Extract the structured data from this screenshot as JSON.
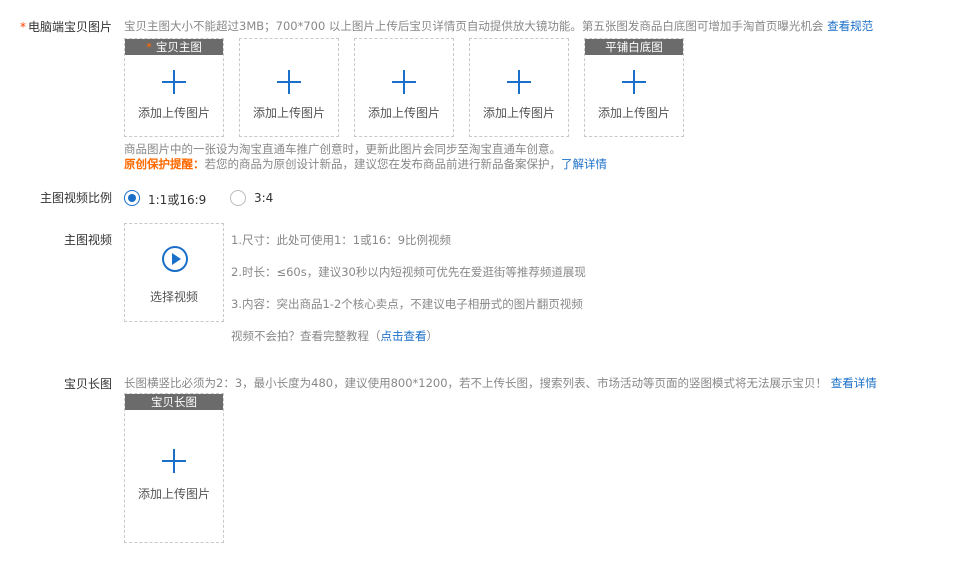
{
  "main_images": {
    "label": "电脑端宝贝图片",
    "required_mark": "*",
    "hint": "宝贝主图大小不能超过3MB；700*700 以上图片上传后宝贝详情页自动提供放大镜功能。第五张图发商品白底图可增加手淘首页曝光机会",
    "hint_link": "查看规范",
    "slots": [
      {
        "tag": "宝贝主图",
        "tag_star": "*",
        "caption": "添加上传图片"
      },
      {
        "tag": "",
        "caption": "添加上传图片"
      },
      {
        "tag": "",
        "caption": "添加上传图片"
      },
      {
        "tag": "",
        "caption": "添加上传图片"
      },
      {
        "tag": "平铺白底图",
        "caption": "添加上传图片"
      }
    ],
    "note": "商品图片中的一张设为淘宝直通车推广创意时，更新此图片会同步至淘宝直通车创意。",
    "protect_title": "原创保护提醒：",
    "protect_text": "若您的商品为原创设计新品，建议您在发布商品前进行新品备案保护，",
    "protect_link": "了解详情"
  },
  "video_ratio": {
    "label": "主图视频比例",
    "options": [
      {
        "label": "1:1或16:9",
        "selected": true
      },
      {
        "label": "3:4",
        "selected": false
      }
    ]
  },
  "main_video": {
    "label": "主图视频",
    "button_label": "选择视频",
    "lines": [
      "1.尺寸：此处可使用1：1或16：9比例视频",
      "2.时长：≤60s，建议30秒以内短视频可优先在爱逛街等推荐频道展现",
      "3.内容：突出商品1-2个核心卖点，不建议电子相册式的图片翻页视频"
    ],
    "tutorial_prefix": "视频不会拍？查看完整教程（",
    "tutorial_link": "点击查看",
    "tutorial_suffix": "）"
  },
  "long_image": {
    "label": "宝贝长图",
    "hint": "长图横竖比必须为2：3，最小长度为480，建议使用800*1200，若不上传长图，搜索列表、市场活动等页面的竖图模式将无法展示宝贝！",
    "hint_link": "查看详情",
    "tag": "宝贝长图",
    "caption": "添加上传图片"
  },
  "colors": {
    "link": "#1a6fc9",
    "required": "#ff4400",
    "warning": "#ff6a00",
    "tag_bg": "#6b6b6b"
  }
}
